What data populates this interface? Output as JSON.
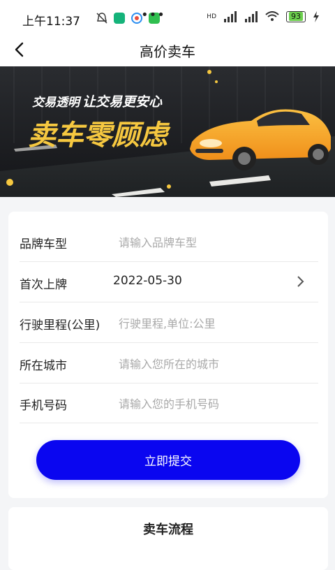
{
  "status_bar": {
    "time": "上午11:37",
    "dots": "•••",
    "network": "HD",
    "battery": "93"
  },
  "nav": {
    "title": "高价卖车",
    "back_icon": "chevron-left-icon"
  },
  "banner": {
    "tagline_left": "交易透明",
    "tagline_right": "让交易更安心",
    "headline": "卖车零顾虑",
    "colors": {
      "headline": "#f6c840",
      "car": "#f9a623",
      "background": "#1b1d20"
    }
  },
  "form": {
    "rows": [
      {
        "label": "品牌车型",
        "placeholder": "请输入品牌车型",
        "value": ""
      },
      {
        "label": "首次上牌",
        "value": "2022-05-30"
      },
      {
        "label": "行驶里程(公里)",
        "placeholder": "行驶里程,单位:公里",
        "value": ""
      },
      {
        "label": "所在城市",
        "placeholder": "请输入您所在的城市",
        "value": ""
      },
      {
        "label": "手机号码",
        "placeholder": "请输入您的手机号码",
        "value": ""
      }
    ],
    "submit_label": "立即提交",
    "accent_color": "#0a06f0"
  },
  "process": {
    "title": "卖车流程"
  }
}
